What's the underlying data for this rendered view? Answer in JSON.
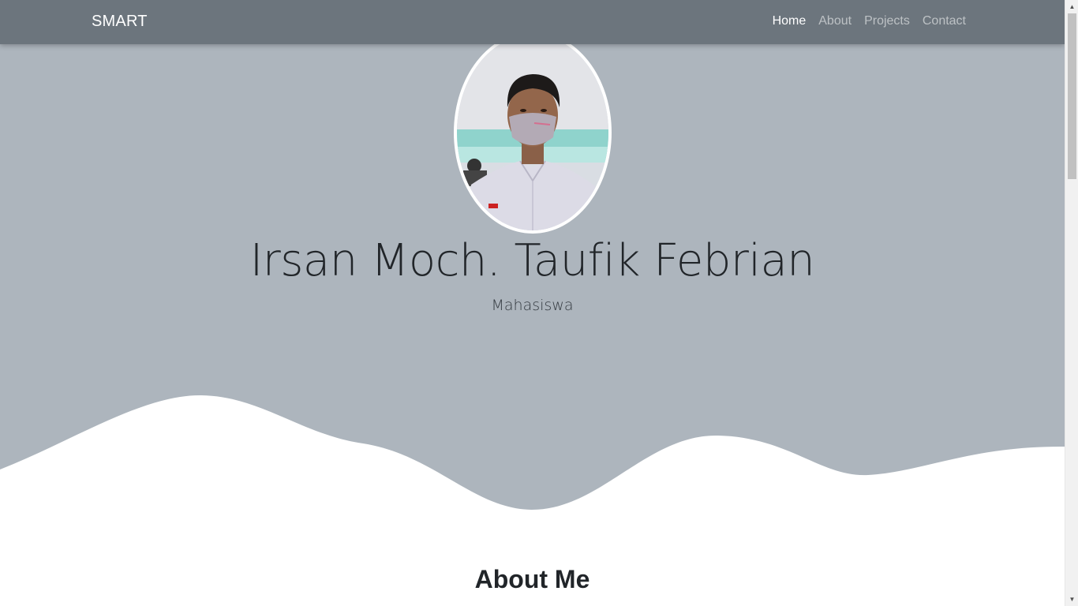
{
  "navbar": {
    "brand": "SMART",
    "links": [
      {
        "label": "Home",
        "active": true
      },
      {
        "label": "About",
        "active": false
      },
      {
        "label": "Projects",
        "active": false
      },
      {
        "label": "Contact",
        "active": false
      }
    ]
  },
  "hero": {
    "name": "Irsan Moch. Taufik Febrian",
    "role": "Mahasiswa"
  },
  "about": {
    "title": "About Me"
  },
  "colors": {
    "navbar": "#6c757d",
    "hero_bg": "#adb5bd",
    "text": "#212529"
  }
}
